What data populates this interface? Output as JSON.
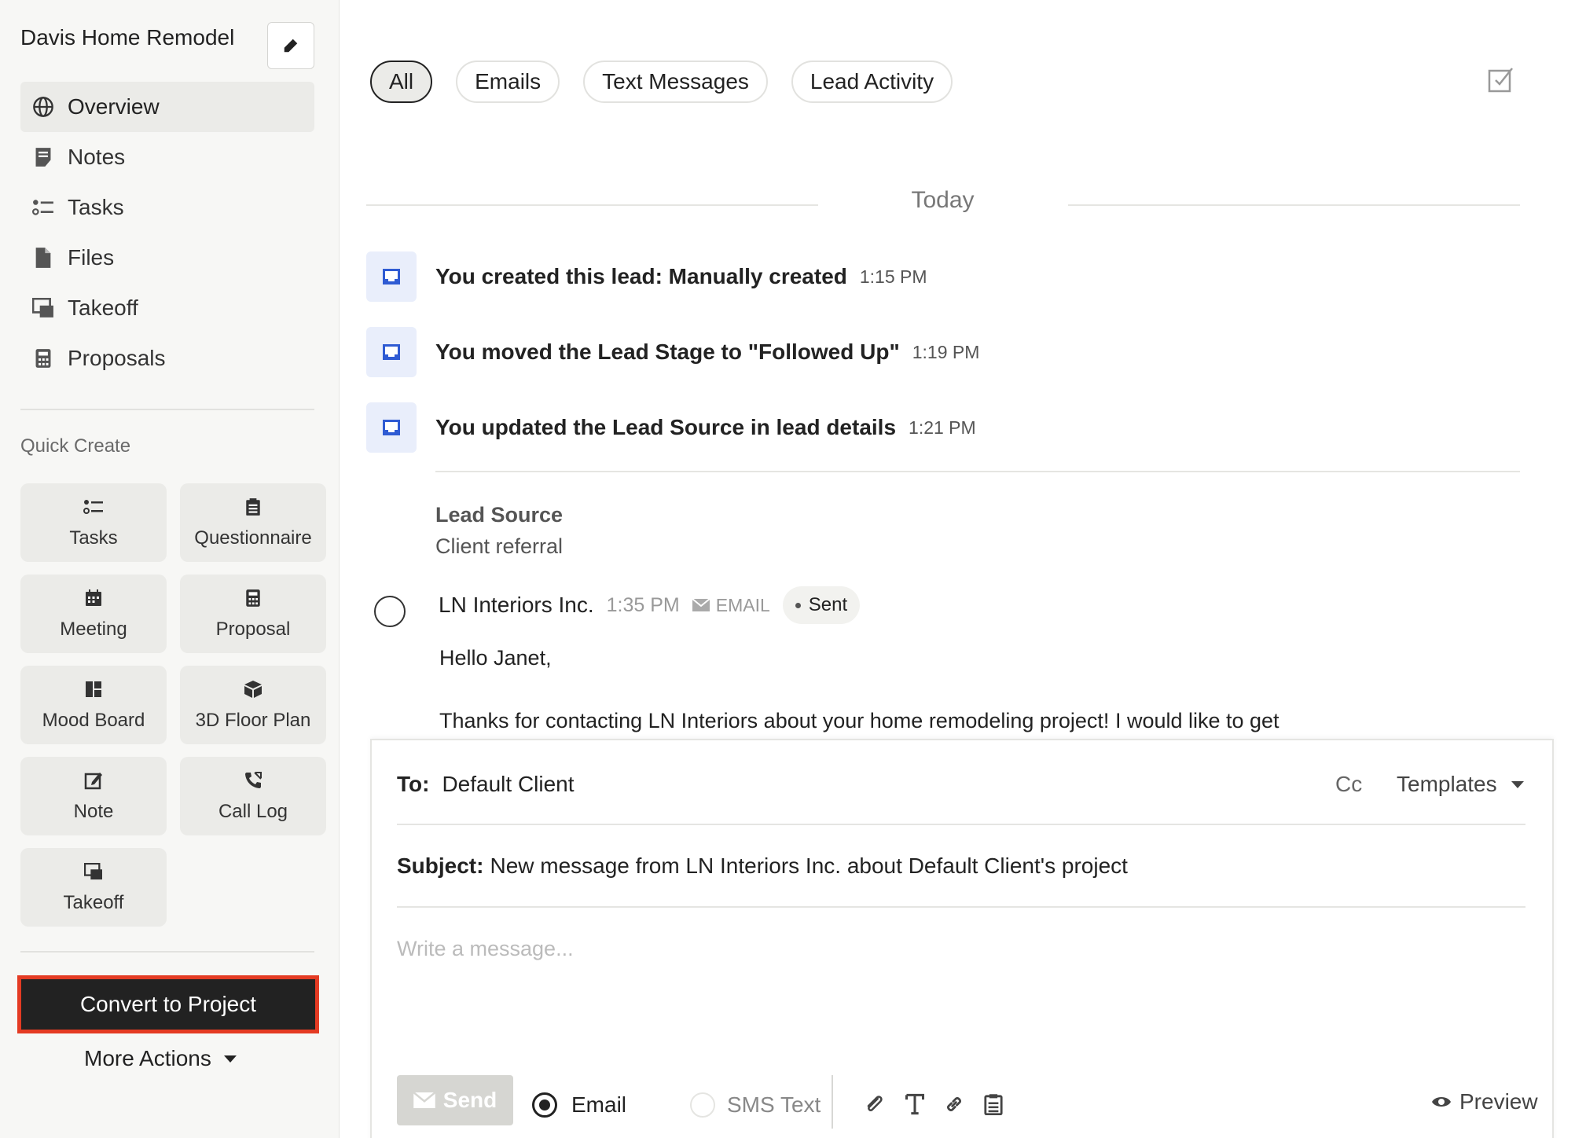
{
  "sidebar": {
    "project_title": "Davis Home Remodel",
    "nav": [
      {
        "label": "Overview",
        "icon": "globe-icon"
      },
      {
        "label": "Notes",
        "icon": "notes-icon"
      },
      {
        "label": "Tasks",
        "icon": "tasks-icon"
      },
      {
        "label": "Files",
        "icon": "file-icon"
      },
      {
        "label": "Takeoff",
        "icon": "takeoff-icon"
      },
      {
        "label": "Proposals",
        "icon": "calculator-icon"
      }
    ],
    "quick_create_label": "Quick Create",
    "quick_create": [
      {
        "label": "Tasks",
        "icon": "tasks-icon"
      },
      {
        "label": "Questionnaire",
        "icon": "clipboard-icon"
      },
      {
        "label": "Meeting",
        "icon": "calendar-icon"
      },
      {
        "label": "Proposal",
        "icon": "calculator-icon"
      },
      {
        "label": "Mood Board",
        "icon": "dashboard-icon"
      },
      {
        "label": "3D Floor Plan",
        "icon": "cube-icon"
      },
      {
        "label": "Note",
        "icon": "edit-note-icon"
      },
      {
        "label": "Call Log",
        "icon": "phone-call-icon"
      },
      {
        "label": "Takeoff",
        "icon": "takeoff-icon"
      }
    ],
    "convert_label": "Convert to Project",
    "more_actions_label": "More Actions"
  },
  "filters": [
    "All",
    "Emails",
    "Text Messages",
    "Lead Activity"
  ],
  "active_filter": "All",
  "timeline": {
    "day_label": "Today",
    "activities": [
      {
        "text": "You created this lead: Manually created",
        "time": "1:15 PM"
      },
      {
        "text": "You moved the Lead Stage to \"Followed Up\"",
        "time": "1:19 PM"
      },
      {
        "text": "You updated the Lead Source in lead details",
        "time": "1:21 PM"
      }
    ],
    "lead_source_label": "Lead Source",
    "lead_source_value": "Client referral",
    "email": {
      "sender": "LN Interiors Inc.",
      "time": "1:35 PM",
      "type": "EMAIL",
      "status": "Sent",
      "greeting": "Hello Janet,",
      "body": "Thanks for contacting LN Interiors about your home remodeling project! I would like to get"
    }
  },
  "composer": {
    "to_label": "To:",
    "to_value": "Default Client",
    "cc_label": "Cc",
    "templates_label": "Templates",
    "subject_label": "Subject:",
    "subject_value": "New message from LN Interiors Inc. about Default Client's project",
    "message_placeholder": "Write a message...",
    "send_label": "Send",
    "channel_email": "Email",
    "channel_sms": "SMS Text",
    "preview_label": "Preview"
  },
  "colors": {
    "highlight_border": "#e43b23",
    "activity_icon": "#2f5bd3",
    "dark_button": "#222222"
  }
}
